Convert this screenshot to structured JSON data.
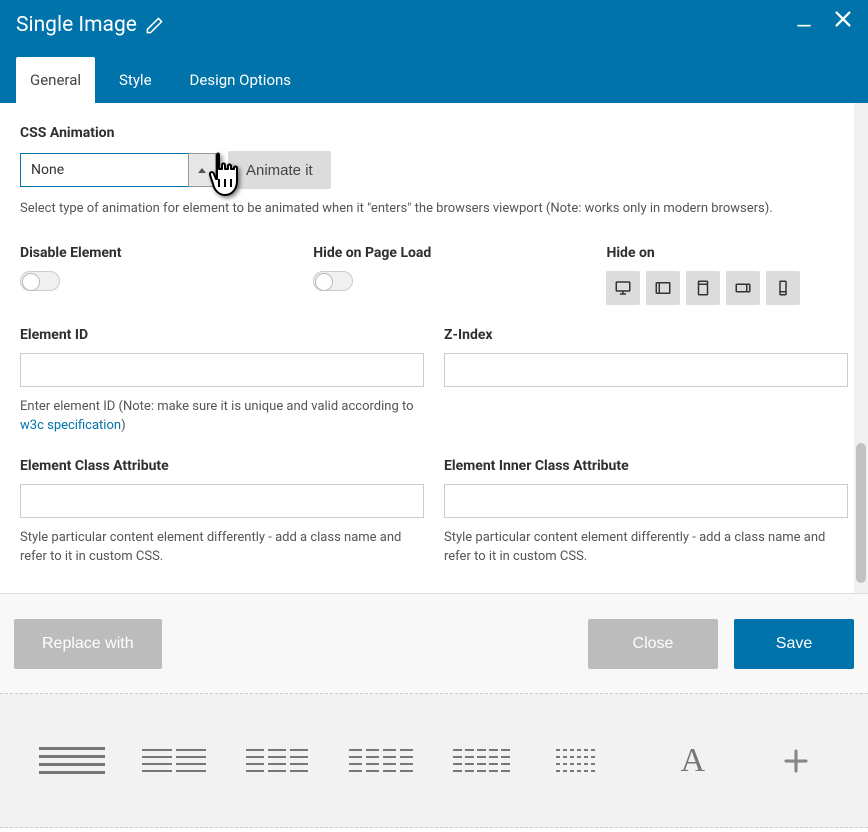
{
  "header": {
    "title": "Single Image"
  },
  "tabs": [
    {
      "label": "General",
      "active": true
    },
    {
      "label": "Style",
      "active": false
    },
    {
      "label": "Design Options",
      "active": false
    }
  ],
  "animation": {
    "label": "CSS Animation",
    "selected": "None",
    "button": "Animate it",
    "help": "Select type of animation for element to be animated when it \"enters\" the browsers viewport (Note: works only in modern browsers)."
  },
  "toggles": {
    "disable_label": "Disable Element",
    "hide_load_label": "Hide on Page Load",
    "hide_on_label": "Hide on"
  },
  "element_id": {
    "label": "Element ID",
    "value": "",
    "help_prefix": "Enter element ID (Note: make sure it is unique and valid according to ",
    "help_link": "w3c specification",
    "help_suffix": ")"
  },
  "zindex": {
    "label": "Z-Index",
    "value": ""
  },
  "class_attr": {
    "label": "Element Class Attribute",
    "value": "",
    "help": "Style particular content element differently - add a class name and refer to it in custom CSS."
  },
  "inner_class_attr": {
    "label": "Element Inner Class Attribute",
    "value": "",
    "help": "Style particular content element differently - add a class name and refer to it in custom CSS."
  },
  "footer": {
    "replace": "Replace with",
    "close": "Close",
    "save": "Save"
  }
}
